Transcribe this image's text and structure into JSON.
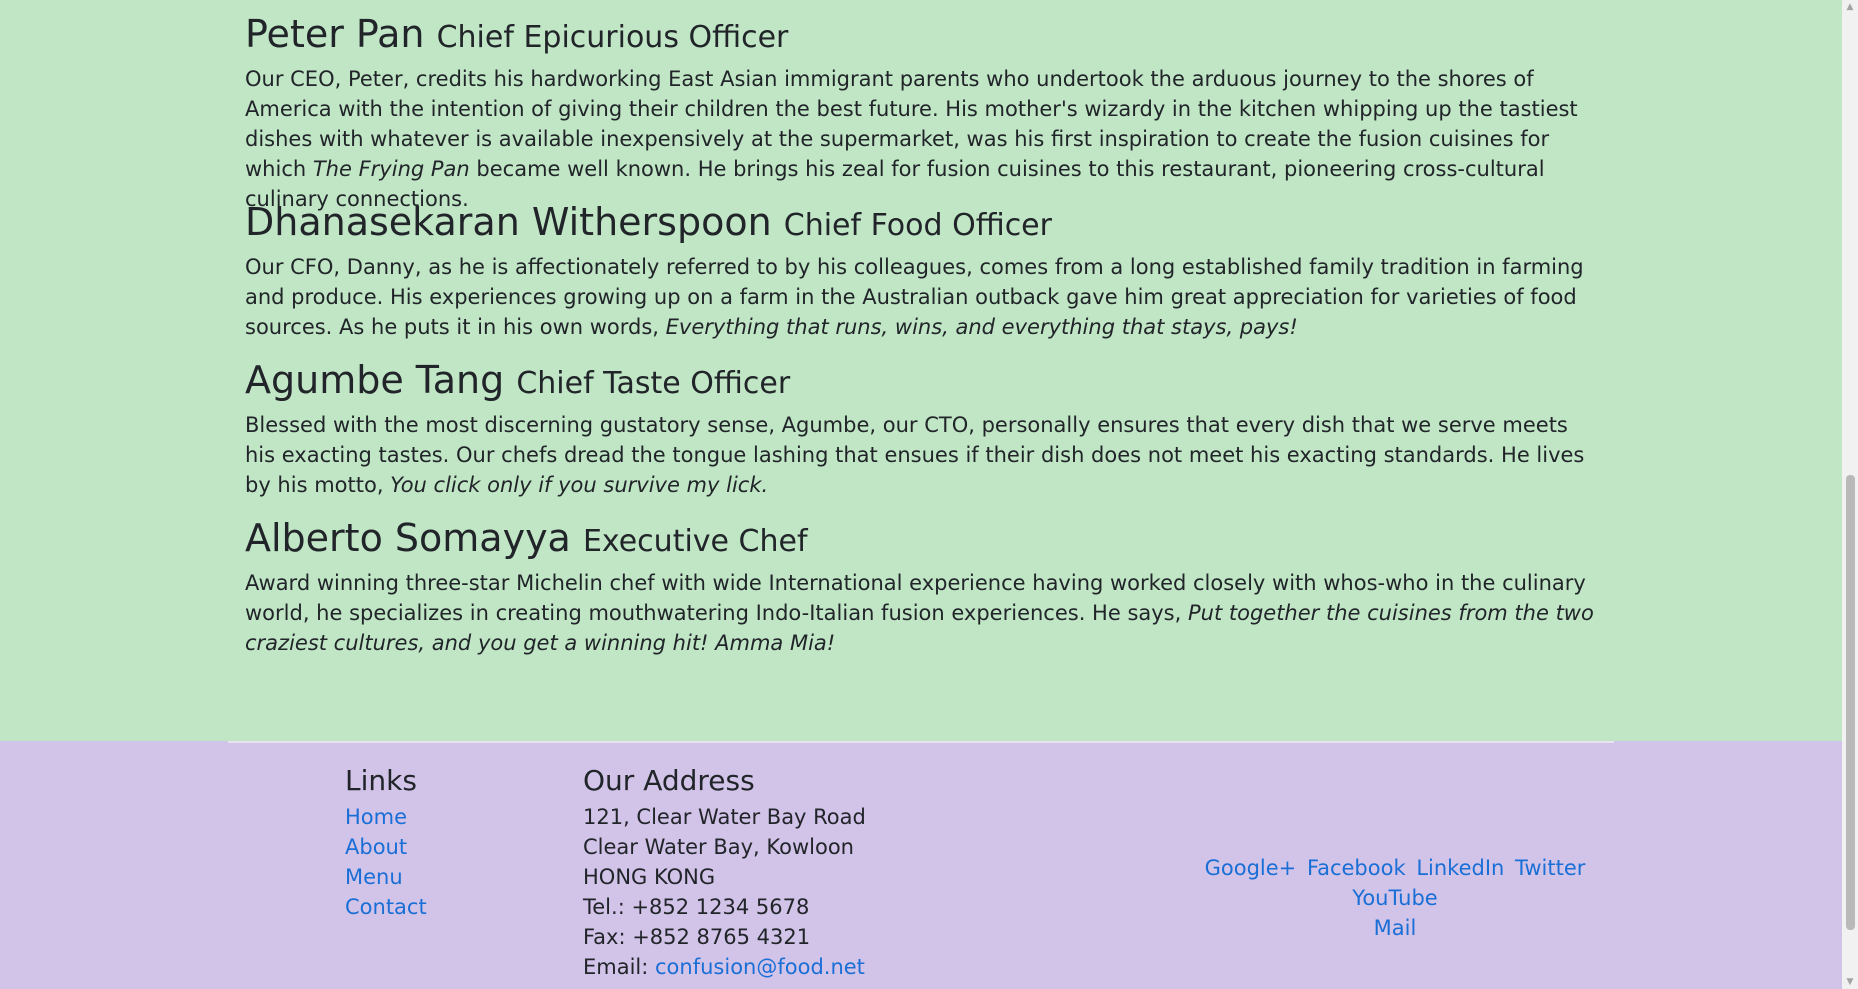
{
  "leaders": [
    {
      "name": "Peter Pan",
      "title": "Chief Epicurious Officer",
      "text_before": "Our CEO, Peter, credits his hardworking East Asian immigrant parents who undertook the arduous journey to the shores of America with the intention of giving their children the best future. His mother's wizardy in the kitchen whipping up the tastiest dishes with whatever is available inexpensively at the supermarket, was his first inspiration to create the fusion cuisines for which ",
      "italic": "The Frying Pan",
      "text_after": " became well known. He brings his zeal for fusion cuisines to this restaurant, pioneering cross-cultural culinary connections."
    },
    {
      "name": "Dhanasekaran Witherspoon",
      "title": "Chief Food Officer",
      "text_before": "Our CFO, Danny, as he is affectionately referred to by his colleagues, comes from a long established family tradition in farming and produce. His experiences growing up on a farm in the Australian outback gave him great appreciation for varieties of food sources. As he puts it in his own words, ",
      "italic": "Everything that runs, wins, and everything that stays, pays!",
      "text_after": ""
    },
    {
      "name": "Agumbe Tang",
      "title": "Chief Taste Officer",
      "text_before": "Blessed with the most discerning gustatory sense, Agumbe, our CTO, personally ensures that every dish that we serve meets his exacting tastes. Our chefs dread the tongue lashing that ensues if their dish does not meet his exacting standards. He lives by his motto, ",
      "italic": "You click only if you survive my lick.",
      "text_after": ""
    },
    {
      "name": "Alberto Somayya",
      "title": "Executive Chef",
      "text_before": "Award winning three-star Michelin chef with wide International experience having worked closely with whos-who in the culinary world, he specializes in creating mouthwatering Indo-Italian fusion experiences. He says, ",
      "italic": "Put together the cuisines from the two craziest cultures, and you get a winning hit! Amma Mia!",
      "text_after": ""
    }
  ],
  "footer": {
    "links_title": "Links",
    "links": [
      "Home",
      "About",
      "Menu",
      "Contact"
    ],
    "address_title": "Our Address",
    "address_lines": [
      "121, Clear Water Bay Road",
      "Clear Water Bay, Kowloon",
      "HONG KONG",
      "Tel.: +852 1234 5678",
      "Fax: +852 8765 4321"
    ],
    "email_label": "Email: ",
    "email": "confusion@food.net",
    "social": [
      "Google+",
      "Facebook",
      "LinkedIn",
      "Twitter",
      "YouTube",
      "Mail"
    ]
  },
  "colors": {
    "content_bg": "#c1e6c6",
    "footer_bg": "#d2c3e8",
    "link": "#1a6fd6"
  }
}
